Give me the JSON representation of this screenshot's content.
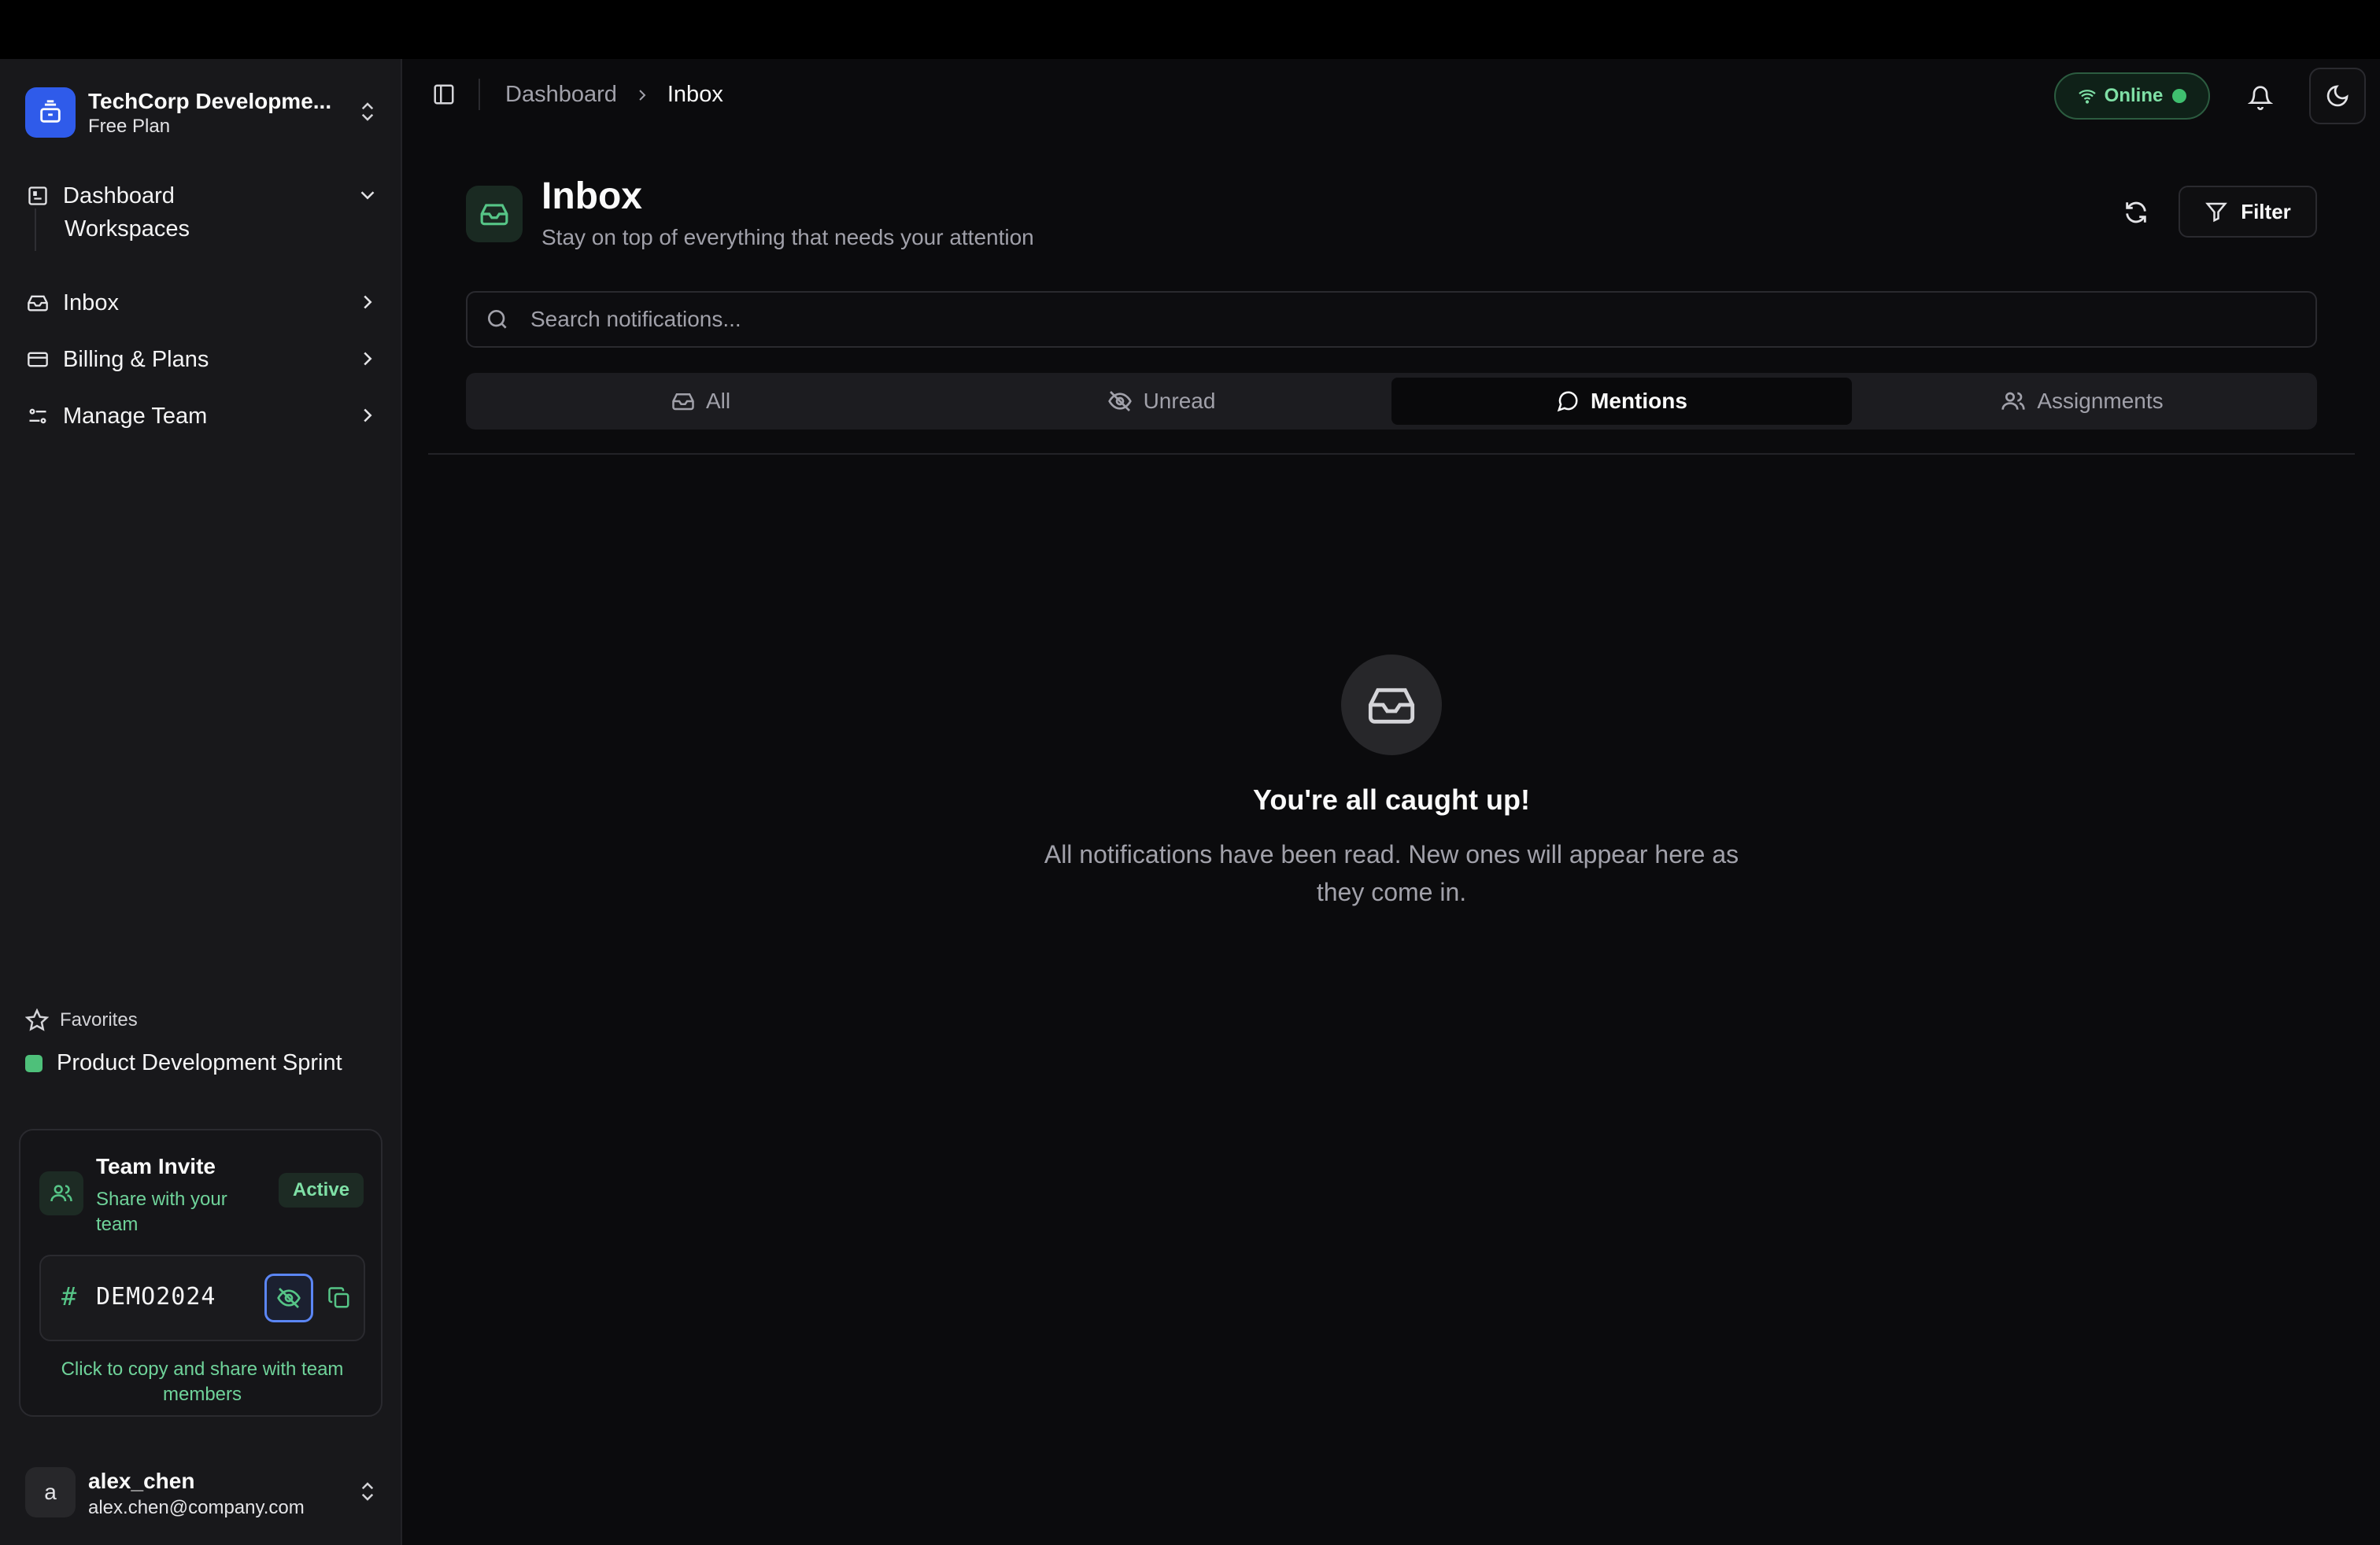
{
  "workspace": {
    "name": "TechCorp Developme...",
    "plan": "Free Plan"
  },
  "nav": {
    "items": [
      {
        "label": "Dashboard",
        "icon": "dashboard-icon",
        "expanded": true,
        "children": [
          "Workspaces"
        ]
      },
      {
        "label": "Inbox",
        "icon": "inbox-icon"
      },
      {
        "label": "Billing & Plans",
        "icon": "credit-card-icon"
      },
      {
        "label": "Manage Team",
        "icon": "team-settings-icon"
      }
    ]
  },
  "favorites": {
    "header": "Favorites",
    "items": [
      {
        "label": "Product Development Sprint",
        "color": "#4ec07a"
      }
    ]
  },
  "invite": {
    "title": "Team Invite",
    "subtitle": "Share with your team",
    "badge": "Active",
    "code": "DEMO2024",
    "footer": "Click to copy and share with team members"
  },
  "user": {
    "avatar": "a",
    "name": "alex_chen",
    "email": "alex.chen@company.com"
  },
  "header": {
    "breadcrumb": [
      "Dashboard",
      "Inbox"
    ],
    "status": "Online"
  },
  "page": {
    "title": "Inbox",
    "subtitle": "Stay on top of everything that needs your attention",
    "filter_label": "Filter"
  },
  "search": {
    "placeholder": "Search notifications...",
    "value": ""
  },
  "tabs": [
    {
      "label": "All",
      "icon": "inbox-icon"
    },
    {
      "label": "Unread",
      "icon": "eye-off-icon"
    },
    {
      "label": "Mentions",
      "icon": "message-circle-icon",
      "active": true
    },
    {
      "label": "Assignments",
      "icon": "users-icon"
    }
  ],
  "empty_state": {
    "title": "You're all caught up!",
    "text": "All notifications have been read. New ones will appear here as they come in."
  },
  "colors": {
    "accent_green": "#4ec07a",
    "brand_blue": "#2f5bea",
    "background": "#0b0b0d",
    "sidebar": "#18181b"
  }
}
